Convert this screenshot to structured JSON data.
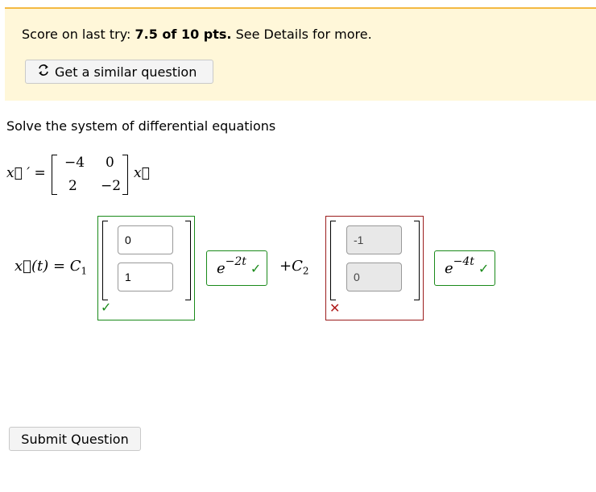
{
  "banner": {
    "score_prefix": "Score on last try: ",
    "score_value": "7.5 of 10 pts.",
    "score_suffix": " See Details for more.",
    "similar_button": "Get a similar question"
  },
  "question": {
    "prompt": "Solve the system of differential equations",
    "lhs": "x⃗ ′ =",
    "matrix": [
      [
        "−4",
        "0"
      ],
      [
        "2",
        "−2"
      ]
    ],
    "rhs_vec": "x⃗"
  },
  "answer": {
    "lhs": "x⃗(t) = C",
    "c1_sub": "1",
    "vec1": [
      "0",
      "1"
    ],
    "vec1_status": "correct",
    "exp1_base": "e",
    "exp1_power": "−2t",
    "plus_c": "+C",
    "c2_sub": "2",
    "vec2": [
      "-1",
      "0"
    ],
    "vec2_status": "incorrect",
    "exp2_base": "e",
    "exp2_power": "−4t"
  },
  "marks": {
    "check": "✓",
    "cross": "✕",
    "refresh": "⟲"
  },
  "submit_button": "Submit Question",
  "colors": {
    "banner_bg": "#fff7d9",
    "banner_border": "#f4b942",
    "correct": "#1a8a1a",
    "incorrect": "#9b1c1c"
  }
}
